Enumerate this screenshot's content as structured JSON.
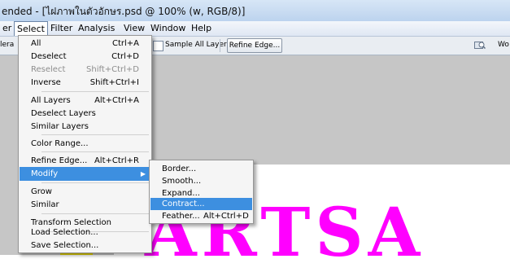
{
  "window": {
    "title": "ended - [ไฝภาพในตัวอักษร.psd @ 100% (w, RGB/8)]"
  },
  "menubar": {
    "items": [
      "er",
      "Select",
      "Filter",
      "Analysis",
      "View",
      "Window",
      "Help"
    ]
  },
  "options": {
    "left_cut": "lera",
    "sample_all_layers": "Sample All Layers",
    "refine_edge": "Refine Edge...",
    "workspace_cut": "Wo"
  },
  "select_menu": {
    "items": [
      {
        "label": "All",
        "shortcut": "Ctrl+A"
      },
      {
        "label": "Deselect",
        "shortcut": "Ctrl+D"
      },
      {
        "label": "Reselect",
        "shortcut": "Shift+Ctrl+D"
      },
      {
        "label": "Inverse",
        "shortcut": "Shift+Ctrl+I"
      },
      {
        "label": "All Layers",
        "shortcut": "Alt+Ctrl+A"
      },
      {
        "label": "Deselect Layers",
        "shortcut": ""
      },
      {
        "label": "Similar Layers",
        "shortcut": ""
      },
      {
        "label": "Color Range...",
        "shortcut": ""
      },
      {
        "label": "Refine Edge...",
        "shortcut": "Alt+Ctrl+R"
      },
      {
        "label": "Modify",
        "shortcut": ""
      },
      {
        "label": "Grow",
        "shortcut": ""
      },
      {
        "label": "Similar",
        "shortcut": ""
      },
      {
        "label": "Transform Selection",
        "shortcut": ""
      },
      {
        "label": "Load Selection...",
        "shortcut": ""
      },
      {
        "label": "Save Selection...",
        "shortcut": ""
      }
    ]
  },
  "modify_menu": {
    "items": [
      {
        "label": "Border...",
        "shortcut": ""
      },
      {
        "label": "Smooth...",
        "shortcut": ""
      },
      {
        "label": "Expand...",
        "shortcut": ""
      },
      {
        "label": "Contract...",
        "shortcut": ""
      },
      {
        "label": "Feather...",
        "shortcut": "Alt+Ctrl+D"
      }
    ]
  },
  "artwork": {
    "text": "ARTSA"
  },
  "colors": {
    "highlight": "#3d8fe0",
    "artwork": "#ff00ff",
    "titlebar": "#c7dbf2"
  },
  "icons": {
    "workspace": "magnifier-window-icon",
    "submenu": "triangle-right-icon"
  }
}
